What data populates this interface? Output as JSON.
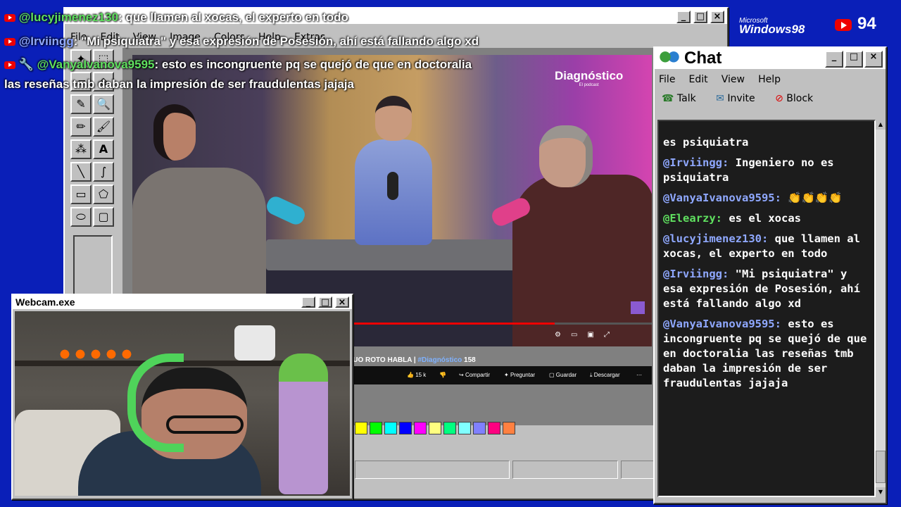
{
  "colors": {
    "desktop": "#0a1fb8",
    "win_gray": "#c0c0c0",
    "chat_bg": "#1c1c1c",
    "user_name": "#8fa8ff",
    "user_green": "#5fe05f"
  },
  "overlay": {
    "lines": [
      {
        "user": "@lucyjimenez130",
        "text": ": que llamen al xocas, el experto en todo"
      },
      {
        "user": "@Irviingg",
        "text": ": \"Mi psiquiatra\" y esa expresión de Posesión, ahí está fallando algo xd"
      },
      {
        "user": "@VanyaIvanova9595",
        "text": ": esto es incongruente pq se quejó de que en doctoralia"
      },
      {
        "user": "",
        "text": "las reseñas tmb daban la impresión de ser fraudulentas jajaja"
      }
    ]
  },
  "top_right": {
    "brand_small": "Microsoft",
    "brand": "Windows98",
    "viewer_count": "94"
  },
  "paint": {
    "menu": [
      "File",
      "Edit",
      "View",
      "Image",
      "Colors",
      "Help",
      "Extras"
    ],
    "video": {
      "logo": "Diagnóstico",
      "logo_sub": "El podcast",
      "title_prefix": "RUO ROTO HABLA | ",
      "hashtag": "#Diagnóstico",
      "title_suffix": " 158",
      "likes": "15 k",
      "share": "Compartir",
      "ask": "Preguntar",
      "save": "Guardar",
      "download": "Descargar"
    }
  },
  "chat": {
    "title": "Chat",
    "menu": [
      "File",
      "Edit",
      "View",
      "Help"
    ],
    "toolbar": {
      "talk": "Talk",
      "invite": "Invite",
      "block": "Block"
    },
    "messages": [
      {
        "user": "",
        "text": "es psiquiatra",
        "green": false
      },
      {
        "user": "@Irviingg:",
        "text": " Ingeniero no es psiquiatra",
        "green": false
      },
      {
        "user": "@VanyaIvanova9595:",
        "text": " 👏👏👏👏",
        "green": false
      },
      {
        "user": "@Elearzy:",
        "text": " es el xocas",
        "green": true
      },
      {
        "user": "@lucyjimenez130:",
        "text": " que llamen al xocas, el experto en todo",
        "green": false
      },
      {
        "user": "@Irviingg:",
        "text": " \"Mi psiquiatra\" y esa expresión de Posesión, ahí está fallando algo xd",
        "green": false
      },
      {
        "user": "@VanyaIvanova9595:",
        "text": " esto es incongruente pq se quejó de que en doctoralia las reseñas tmb daban la impresión de ser fraudulentas jajaja",
        "green": false
      }
    ]
  },
  "webcam": {
    "title": "Webcam.exe"
  }
}
